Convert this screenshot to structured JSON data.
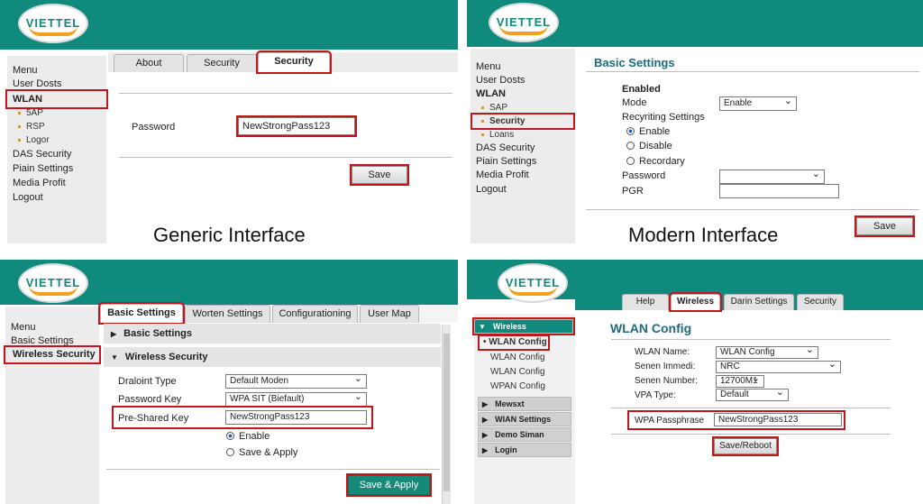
{
  "brand": {
    "logo_text": "VIETTEL"
  },
  "colors": {
    "header": "#0f8a7c",
    "highlight": "#c0161c",
    "logo_accent": "#f0a21c"
  },
  "q1": {
    "caption": "Generic Interface",
    "tabs": [
      "About",
      "Security",
      "Security"
    ],
    "menu": [
      "Menu",
      "User Dosts",
      "WLAN",
      "5AP",
      "RSP",
      "Logor",
      "DAS Security",
      "Piain Settings",
      "Media Profit",
      "Logout"
    ],
    "password_label": "Password",
    "password_value": "NewStrongPass123",
    "save_label": "Save"
  },
  "q2": {
    "caption": "Modern Interface",
    "title": "Basic Settings",
    "menu": [
      "Menu",
      "User Dosts",
      "WLAN",
      "SAP",
      "Security",
      "Loans",
      "DAS Security",
      "Piain Settings",
      "Media Profit",
      "Logout"
    ],
    "enabled_label": "Enabled",
    "mode_label": "Mode",
    "mode_value": "Enable",
    "recyriting_label": "Recyriting Settings",
    "radios": [
      "Enable",
      "Disable",
      "Recordary"
    ],
    "password_label": "Password",
    "pgr_label": "PGR",
    "save_label": "Save"
  },
  "q3": {
    "tabs": [
      "Basic Settings",
      "Worten Settings",
      "Configurationing",
      "User Map"
    ],
    "menu": [
      "Menu",
      "Basic Settings",
      "Wireless Security"
    ],
    "section1": "Basic Settings",
    "section2": "Wireless Security",
    "draloint_label": "Draloint Type",
    "draloint_value": "Default Moden",
    "pwkey_label": "Password Key",
    "pwkey_value": "WPA SIT (Biefault)",
    "psk_label": "Pre-Shared Key",
    "psk_value": "NewStrongPass123",
    "radios": [
      "Enable",
      "Save & Apply"
    ],
    "save_label": "Save & Apply"
  },
  "q4": {
    "tabs": [
      "Help",
      "Wireless",
      "Darin Settings",
      "Security"
    ],
    "menu": [
      "Wireless",
      "WLAN Config",
      "WLAN Config",
      "WLAN Config",
      "WPAN Config",
      "Mewsxt",
      "WIAN Settings",
      "Demo Siman",
      "Login"
    ],
    "title": "WLAN Config",
    "fields": [
      {
        "label": "WLAN Name:",
        "value": "WLAN Config"
      },
      {
        "label": "Senen Immedi:",
        "value": "NRC"
      },
      {
        "label": "Senen Number:",
        "value": "12700M1"
      },
      {
        "label": "VPA Type:",
        "value": "Default"
      }
    ],
    "wpa_label": "WPA Passphrase",
    "wpa_value": "NewStrongPass123",
    "save_label": "Save/Reboot"
  }
}
